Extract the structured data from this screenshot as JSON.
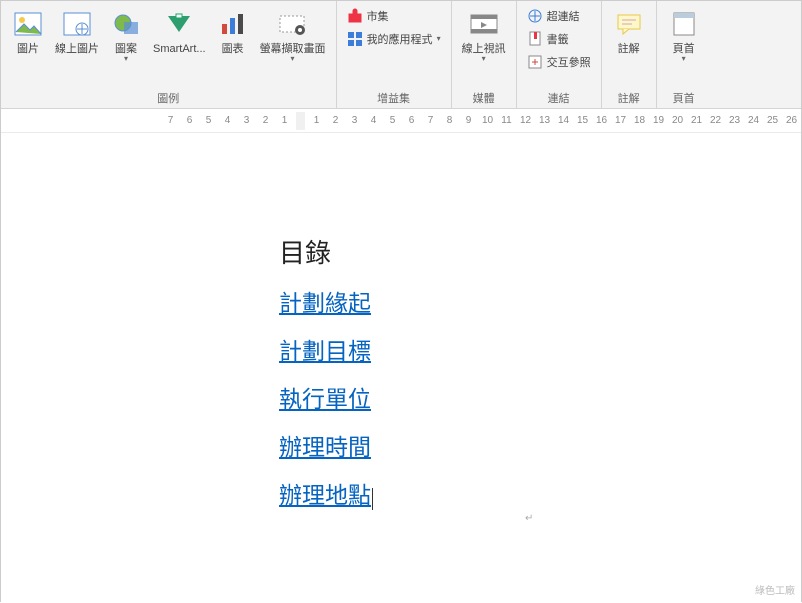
{
  "ribbon": {
    "groups": {
      "illustrations": {
        "label": "圖例",
        "picture": "圖片",
        "online_pictures": "線上圖片",
        "shapes": "圖案",
        "smartart": "SmartArt...",
        "chart": "圖表",
        "screenshot": "螢幕擷取畫面"
      },
      "addins": {
        "label": "增益集",
        "store": "市集",
        "my_apps": "我的應用程式"
      },
      "media": {
        "label": "媒體",
        "online_video": "線上視訊"
      },
      "links": {
        "label": "連結",
        "hyperlink": "超連結",
        "bookmark": "書籤",
        "cross_ref": "交互參照"
      },
      "comments": {
        "label": "註解",
        "comment": "註解"
      },
      "header_footer": {
        "label": "頁首",
        "header": "頁首"
      }
    }
  },
  "ruler": {
    "before": [
      "7",
      "6",
      "5",
      "4",
      "3",
      "2",
      "1"
    ],
    "main": [
      "1",
      "2",
      "3",
      "4",
      "5",
      "6",
      "7",
      "8",
      "9",
      "10",
      "11",
      "12",
      "13",
      "14",
      "15",
      "16",
      "17",
      "18",
      "19",
      "20",
      "21",
      "22",
      "23",
      "24",
      "25",
      "26"
    ]
  },
  "document": {
    "toc_title": "目錄",
    "links": [
      "計劃緣起",
      "計劃目標",
      "執行單位",
      "辦理時間",
      "辦理地點"
    ]
  },
  "watermark": "綠色工廠"
}
